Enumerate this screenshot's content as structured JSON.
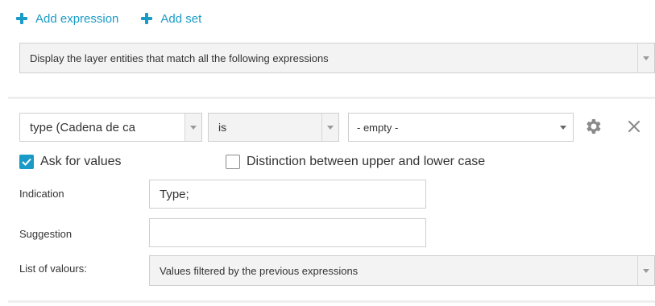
{
  "actions": {
    "add_expression": "Add expression",
    "add_set": "Add set"
  },
  "mode_select": {
    "value": "Display the layer entities that match all the following expressions"
  },
  "expression": {
    "field_select": "type (Cadena de ca",
    "operator_select": "is",
    "value_select": "- empty -"
  },
  "options": {
    "ask_for_values": {
      "label": "Ask for values",
      "checked": true
    },
    "case_sensitive": {
      "label": "Distinction between upper and lower case",
      "checked": false
    }
  },
  "indication": {
    "label": "Indication",
    "value": "Type;"
  },
  "suggestion": {
    "label": "Suggestion",
    "value": ""
  },
  "list_of_values": {
    "label": "List of valours:",
    "value": "Values filtered by the previous expressions"
  },
  "colors": {
    "accent": "#1a9bc7",
    "border": "#cfcfcf",
    "icon_grey": "#8a8a8a"
  },
  "icons": [
    "plus-icon",
    "gear-icon",
    "close-icon",
    "chevron-down-icon",
    "checkmark-icon"
  ]
}
